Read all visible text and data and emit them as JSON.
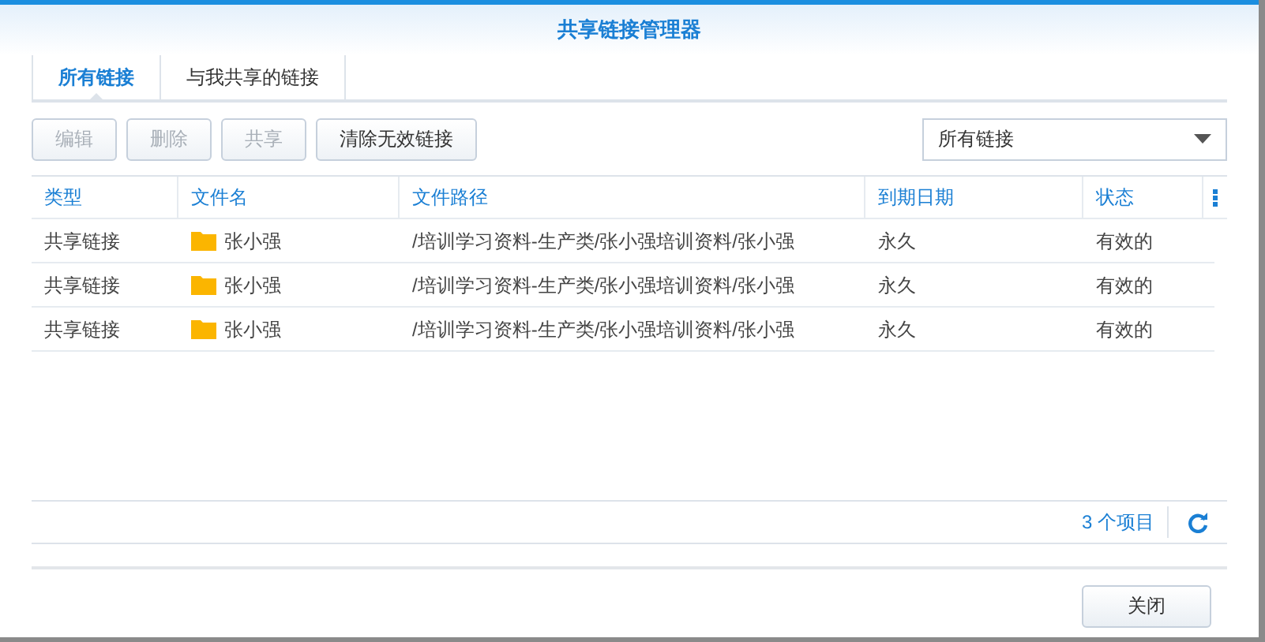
{
  "window": {
    "title": "共享链接管理器"
  },
  "tabs": [
    {
      "label": "所有链接",
      "selected": true
    },
    {
      "label": "与我共享的链接",
      "selected": false
    }
  ],
  "toolbar": {
    "buttons": [
      {
        "label": "编辑",
        "disabled": true
      },
      {
        "label": "删除",
        "disabled": true
      },
      {
        "label": "共享",
        "disabled": true
      },
      {
        "label": "清除无效链接",
        "disabled": false
      }
    ],
    "filter": {
      "value": "所有链接"
    }
  },
  "table": {
    "columns": [
      "类型",
      "文件名",
      "文件路径",
      "到期日期",
      "状态"
    ],
    "rows": [
      {
        "type": "共享链接",
        "name": "张小强",
        "path": "/培训学习资料-生产类/张小强培训资料/张小强",
        "expiry": "永久",
        "status": "有效的"
      },
      {
        "type": "共享链接",
        "name": "张小强",
        "path": "/培训学习资料-生产类/张小强培训资料/张小强",
        "expiry": "永久",
        "status": "有效的"
      },
      {
        "type": "共享链接",
        "name": "张小强",
        "path": "/培训学习资料-生产类/张小强培训资料/张小强",
        "expiry": "永久",
        "status": "有效的"
      }
    ]
  },
  "footer": {
    "count": "3 个项目"
  },
  "buttons": [
    "关闭"
  ]
}
